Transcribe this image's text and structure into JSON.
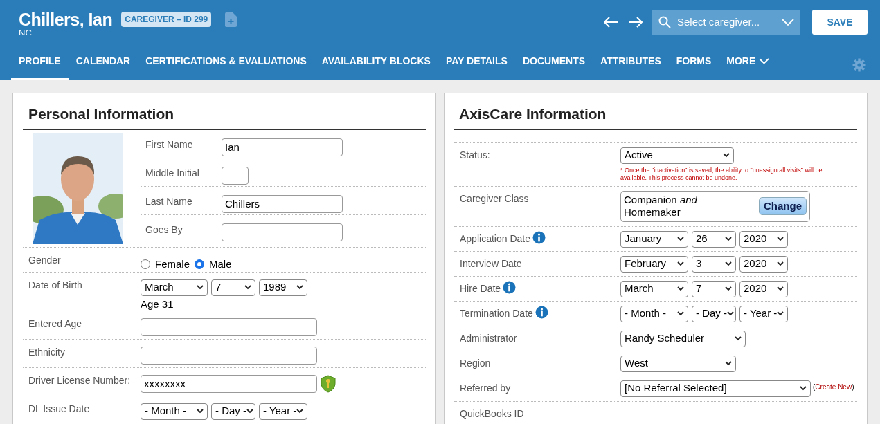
{
  "header": {
    "name": "Chillers, Ian",
    "badge": "CAREGIVER – ID 299",
    "subtitle": "NC",
    "search": {
      "placeholder": "Select caregiver..."
    },
    "save": "SAVE"
  },
  "tabs": [
    {
      "label": "PROFILE",
      "selected": true
    },
    {
      "label": "CALENDAR",
      "selected": false
    },
    {
      "label": "CERTIFICATIONS & EVALUATIONS",
      "selected": false
    },
    {
      "label": "AVAILABILITY BLOCKS",
      "selected": false
    },
    {
      "label": "PAY DETAILS",
      "selected": false
    },
    {
      "label": "DOCUMENTS",
      "selected": false
    },
    {
      "label": "ATTRIBUTES",
      "selected": false
    },
    {
      "label": "FORMS",
      "selected": false
    },
    {
      "label": "MORE",
      "selected": false
    }
  ],
  "personal": {
    "title": "Personal Information",
    "name_fields": [
      {
        "label": "First Name",
        "kind": "name",
        "value": "Ian"
      },
      {
        "label": "Middle Initial",
        "kind": "initial"
      },
      {
        "label": "Last Name",
        "kind": "name",
        "value": "Chillers"
      },
      {
        "label": "Goes By",
        "kind": "name"
      }
    ],
    "rows": [
      {
        "label": "Gender",
        "kind": "radio",
        "options": [
          {
            "label": "Female",
            "selected": false
          },
          {
            "label": "Male",
            "selected": true
          }
        ]
      },
      {
        "label": "Date of Birth",
        "kind": "date",
        "selects": [
          "March",
          "7",
          "1989"
        ],
        "note": "Age 31"
      },
      {
        "label": "Entered Age",
        "kind": "input"
      },
      {
        "label": "Ethnicity",
        "kind": "input"
      },
      {
        "label": "Driver License Number:",
        "kind": "secure_input",
        "value": "xxxxxxxx"
      },
      {
        "label": "DL Issue Date",
        "kind": "date",
        "selects": [
          "- Month -",
          "- Day -",
          "- Year -"
        ]
      }
    ]
  },
  "axiscare": {
    "title": "AxisCare Information",
    "rows": [
      {
        "label": "Status:",
        "kind": "select",
        "value": "Active",
        "warning": "* Once the \"inactivation\" is saved, the ability to \"unassign all visits\" will be available. This process cannot be undone."
      },
      {
        "label": "Caregiver Class",
        "kind": "class",
        "value": "Companion *and* Homemaker",
        "button": "Change"
      },
      {
        "label": "Application Date",
        "kind": "date",
        "info": true,
        "selects": [
          "January",
          "26",
          "2020"
        ]
      },
      {
        "label": "Interview Date",
        "kind": "date",
        "selects": [
          "February",
          "3",
          "2020"
        ]
      },
      {
        "label": "Hire Date",
        "kind": "date",
        "info": true,
        "selects": [
          "March",
          "7",
          "2020"
        ]
      },
      {
        "label": "Termination Date",
        "kind": "date",
        "info": true,
        "selects": [
          "- Month -",
          "- Day -",
          "- Year -"
        ]
      },
      {
        "label": "Administrator",
        "kind": "select",
        "value": "Randy Scheduler"
      },
      {
        "label": "Region",
        "kind": "select",
        "value": "West"
      },
      {
        "label": "Referred by",
        "kind": "select",
        "value": "[No Referral Selected]",
        "link_open": "(",
        "link": "Create New",
        "link_close": ")"
      },
      {
        "label": "QuickBooks ID",
        "kind": "label"
      }
    ]
  }
}
